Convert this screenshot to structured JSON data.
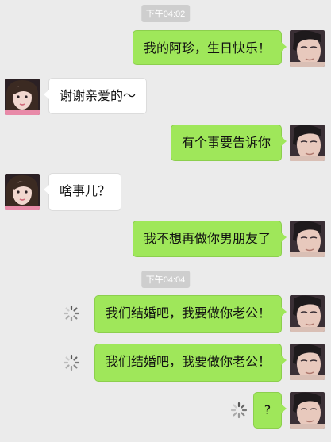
{
  "chat": {
    "timestamps": [
      "下午04:02",
      "下午04:04"
    ],
    "messages": [
      {
        "side": "me",
        "text": "我的阿珍，生日快乐！",
        "status": "sent"
      },
      {
        "side": "her",
        "text": "谢谢亲爱的～"
      },
      {
        "side": "me",
        "text": "有个事要告诉你",
        "status": "sent"
      },
      {
        "side": "her",
        "text": "啥事儿？"
      },
      {
        "side": "me",
        "text": "我不想再做你男朋友了",
        "status": "sent"
      },
      {
        "side": "me",
        "text": "我们结婚吧，我要做你老公！",
        "status": "sending"
      },
      {
        "side": "me",
        "text": "我们结婚吧，我要做你老公！",
        "status": "sending"
      },
      {
        "side": "me",
        "text": "?",
        "status": "sending"
      }
    ]
  },
  "icons": {
    "avatar_me": "male-avatar-icon",
    "avatar_her": "female-avatar-icon",
    "sending": "loading-spinner-icon"
  },
  "colors": {
    "background": "#ebebeb",
    "my_bubble": "#9fe75a",
    "her_bubble": "#ffffff",
    "timestamp_bg": "#cecece"
  }
}
